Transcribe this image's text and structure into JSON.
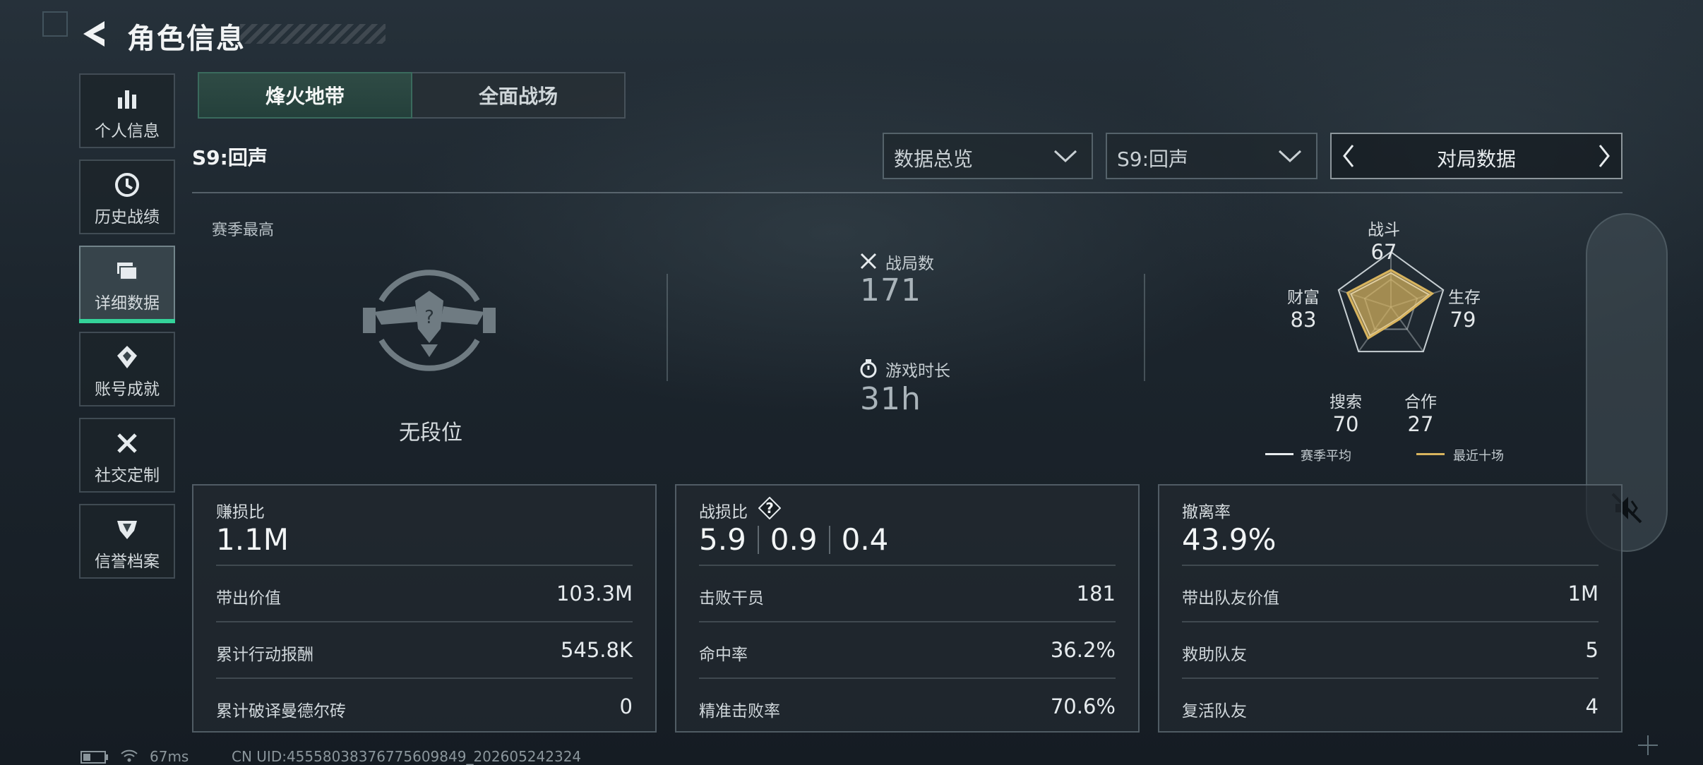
{
  "header": {
    "title": "角色信息"
  },
  "sidebar": {
    "items": [
      {
        "label": "个人信息",
        "icon": "bar-chart-icon"
      },
      {
        "label": "历史战绩",
        "icon": "history-clock-icon"
      },
      {
        "label": "详细数据",
        "icon": "folder-icon",
        "active": true
      },
      {
        "label": "账号成就",
        "icon": "medal-icon"
      },
      {
        "label": "社交定制",
        "icon": "tools-icon"
      },
      {
        "label": "信誉档案",
        "icon": "shield-badge-icon"
      }
    ]
  },
  "tabs": [
    {
      "label": "烽火地带",
      "active": true
    },
    {
      "label": "全面战场",
      "active": false
    }
  ],
  "season_label": "S9:回声",
  "filters": {
    "view": "数据总览",
    "season": "S9:回声",
    "switcher": "对局数据"
  },
  "summary": {
    "season_best_label": "赛季最高",
    "rank_text": "无段位",
    "matches_label": "战局数",
    "matches_value": "171",
    "playtime_label": "游戏时长",
    "playtime_value": "31h"
  },
  "radar": {
    "axes": [
      {
        "label": "战斗",
        "value": "67"
      },
      {
        "label": "生存",
        "value": "79"
      },
      {
        "label": "合作",
        "value": "27"
      },
      {
        "label": "搜索",
        "value": "70"
      },
      {
        "label": "财富",
        "value": "83"
      }
    ],
    "legend": [
      {
        "label": "赛季平均",
        "color": "#e8ecee"
      },
      {
        "label": "最近十场",
        "color": "#d8b45e"
      }
    ]
  },
  "panels": {
    "profit": {
      "title": "赚损比",
      "value": "1.1M",
      "rows": [
        {
          "label": "带出价值",
          "value": "103.3M"
        },
        {
          "label": "累计行动报酬",
          "value": "545.8K"
        },
        {
          "label": "累计破译曼德尔砖",
          "value": "0"
        }
      ]
    },
    "combat": {
      "title": "战损比",
      "values": [
        "5.9",
        "0.9",
        "0.4"
      ],
      "rows": [
        {
          "label": "击败干员",
          "value": "181"
        },
        {
          "label": "命中率",
          "value": "36.2%"
        },
        {
          "label": "精准击败率",
          "value": "70.6%"
        }
      ]
    },
    "extract": {
      "title": "撤离率",
      "value": "43.9%",
      "rows": [
        {
          "label": "带出队友价值",
          "value": "1M"
        },
        {
          "label": "救助队友",
          "value": "5"
        },
        {
          "label": "复活队友",
          "value": "4"
        }
      ]
    }
  },
  "status_bar": {
    "ping": "67ms",
    "uid": "CN UID:45558038376775609849_202605242324"
  },
  "colors": {
    "accent": "#34d39a",
    "radar_fill": "#d8b45e"
  }
}
